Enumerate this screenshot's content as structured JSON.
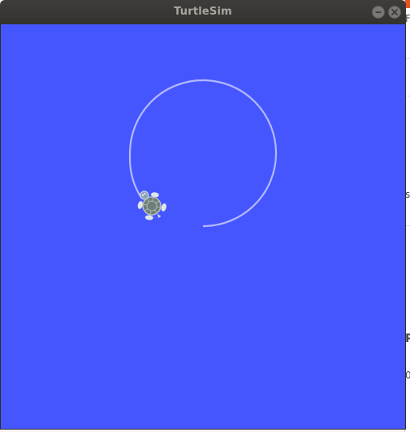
{
  "window": {
    "title": "TurtleSim"
  },
  "canvas": {
    "background_color": "#4556ff",
    "trail_color": "#b3b8ff"
  },
  "turtle": {
    "icon": "turtle-icon"
  },
  "controls": {
    "minimize_icon": "minimize-icon",
    "close_icon": "close-icon"
  }
}
